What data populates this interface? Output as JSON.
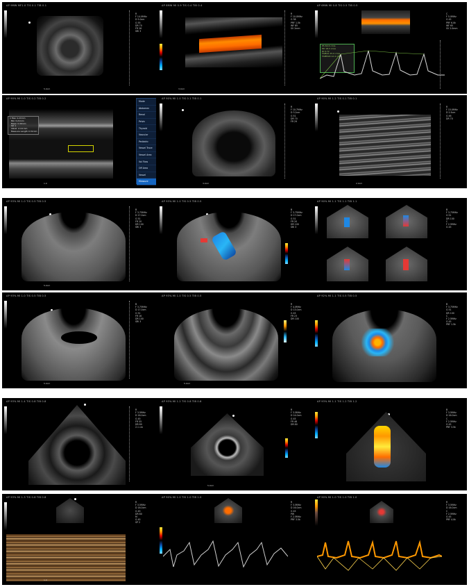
{
  "rows": [
    {
      "panels": [
        {
          "header": "AP 9MW  MF1.0  TIS 0.1  TIB 0.1",
          "info": "R\nF 14.0MHz\nD 5.0cm\nG 55\nDR 70\nFR 26\nSRI 3",
          "marker": "5.0cm",
          "icon": "thyroid-transverse-image"
        },
        {
          "header": "AP 8MW  MI 0.9  TIS 0.4  TIB 0.4",
          "info": "R\nF 10.0MHz\nG 38\nPRF 1.5k\nWF 85\nSV 2mm",
          "marker": "3.0cm",
          "icon": "carotid-color-doppler-image"
        },
        {
          "header": "AP 6MW  MI 0.8  TIS 0.5  TIB 0.5",
          "info": "C\nF 5.0MHz\nG 45\nPRF 6.0k\nWF 65\nSV 2.0mm",
          "marker": "",
          "icon": "carotid-spectral-doppler-image"
        }
      ]
    },
    {
      "panels": [
        {
          "header": "AP 90%  MI 1.0  TIS 0.2  TIB 0.2",
          "info": "",
          "marker": "1.0",
          "icon": "vessel-measurement-image"
        },
        {
          "header": "AP 90%  MI 1.0  TIS 0.1  TIB 0.1",
          "info": "R\nF 10.7MHz\nD 3.2cm\nG 51\nDR 70\nFR 29",
          "marker": "3.0cm",
          "icon": "bladder-image"
        },
        {
          "header": "AP 90%  MI 1.2  TIS 0.1  TIB 0.1",
          "info": "R\nF 15.0MHz\nD 2.5cm\nG 46\nDR 70",
          "marker": "2.0cm",
          "icon": "muscle-tissue-image"
        }
      ]
    },
    {
      "panels": [
        {
          "header": "AP 93%  MI 1.0  TIS 0.5  TIB 0.5",
          "info": "B\nF 3.75MHz\nD 17.0cm\nG 51\nFR 20\nDR 100\nSRI 3",
          "marker": "5.0cm",
          "icon": "liver-image"
        },
        {
          "header": "AP 93%  MI 1.0  TIS 0.5  TIB 0.5",
          "info": "B\nF 3.75MHz\nD 17.0cm\nG 51\nFR 20\nDR 100\nSRI 3",
          "marker": "",
          "icon": "liver-color-doppler-image"
        },
        {
          "header": "AP 90%  MI 1.1  TIS 1.1  TIB 1.1",
          "info": "B\nF 3.75MHz\nG 51\nDR 100\nC\nF 2.5MHz\nG 45",
          "marker": "",
          "icon": "liver-quad-view-image"
        }
      ]
    },
    {
      "panels": [
        {
          "header": "AP 93%  MI 1.0  TIS 0.5  TIB 0.5",
          "info": "B\nF 3.75MHz\nD 17.0cm\nG 51\nFR 16\nDR 100\nSRI 3",
          "marker": "5.0cm",
          "icon": "gallbladder-image"
        },
        {
          "header": "AP 93%  MI 1.0  TIS 0.5  TIB 0.5",
          "info": "R\nF 4.0MHz\nD 13.0cm\nG 45\nFR 23\nDR 100",
          "marker": "5.0cm",
          "icon": "abdomen-bowel-image"
        },
        {
          "header": "AP 92%  MI 1.1  TIS 0.5  TIB 0.5",
          "info": "B\nF 3.75MHz\nG 51\nDR 100\nC\nF 2.5MHz\nG 45\nPRF 1.5k",
          "marker": "",
          "icon": "kidney-color-doppler-image"
        }
      ]
    },
    {
      "panels": [
        {
          "header": "AP 93%  MI 1.4  TIS 0.8  TIB 0.8",
          "info": "R\nF 3.5MHz\nD 16.0cm\nG 45\nFR 55\nDR 80\n2.1 cm",
          "marker": "",
          "icon": "cardiac-long-axis-image"
        },
        {
          "header": "AP 93%  MI 1.2  TIS 0.8  TIB 0.8",
          "info": "R\nF 3.5MHz\nD 14.0cm\nG 45\nFR 46\nDR 80",
          "marker": "5.0cm",
          "icon": "cardiac-short-axis-image"
        },
        {
          "header": "AP 93%  MI 1.1  TIS 1.2  TIB 1.2",
          "info": "B\nF 3.5MHz\nD 16.0cm\nC\nF 2.5MHz\nG 45\nPRF 3.5k",
          "marker": "",
          "icon": "cardiac-color-doppler-image"
        }
      ]
    },
    {
      "panels": [
        {
          "header": "AP 93%  MI 1.3  TIS 0.8  TIB 0.8",
          "info": "R\nF 3.5MHz\nD 16.0cm\nG 45\nDR 80\nM\nG 45\nSP 2",
          "marker": "1.0",
          "icon": "cardiac-m-mode-image"
        },
        {
          "header": "AP 90%  MI 1.0  TIS 1.0  TIB 1.0",
          "info": "R\nF 3.5MHz\nD 16.0cm\nG 45\nPW\nF 2.5MHz\nPRF 3.5k",
          "marker": "",
          "icon": "cardiac-pw-doppler-image"
        },
        {
          "header": "AP 90%  MI 1.0  TIS 1.0  TIB 1.0",
          "info": "R\nF 3.5MHz\nD 16.0cm\nC\nF 2.5MHz\nG 45\nPRF 4.0k",
          "marker": "",
          "icon": "cardiac-cw-doppler-image"
        }
      ]
    }
  ],
  "menu": {
    "items": [
      "Mode",
      "Abdomen",
      "Renal",
      "Pelvic",
      "Thyroid",
      "Vascular",
      "Pediatric",
      "Vessel Trace",
      "Vessel Area",
      "Vol Flow",
      "Off Area",
      "Vessel",
      "Measure"
    ],
    "selected": "Measure"
  },
  "measure_box": "1 Max 4.24mm\n  Min 3.21mm\n  Mean 3.36mm\n  SD 1\n  VOLR  13.8 mm\n  Measure Length 0.31mm"
}
